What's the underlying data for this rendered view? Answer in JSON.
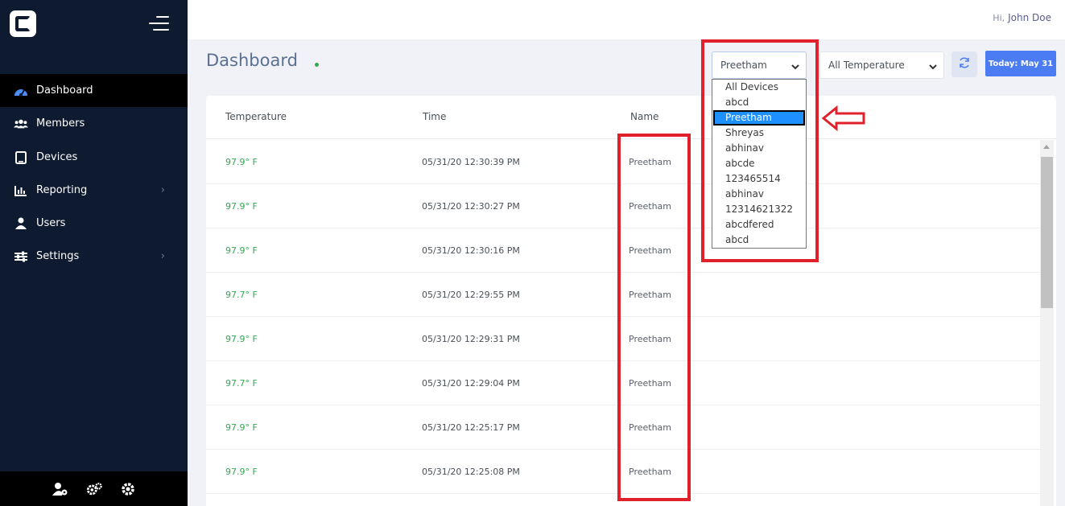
{
  "sidebar": {
    "items": [
      {
        "label": "Dashboard",
        "icon": "dashboard-icon",
        "active": true
      },
      {
        "label": "Members",
        "icon": "members-icon"
      },
      {
        "label": "Devices",
        "icon": "tablet-icon"
      },
      {
        "label": "Reporting",
        "icon": "bar-chart-icon",
        "has_submenu": true
      },
      {
        "label": "Users",
        "icon": "user-icon"
      },
      {
        "label": "Settings",
        "icon": "sliders-icon",
        "has_submenu": true
      }
    ],
    "bottom_icons": [
      "user-settings-icon",
      "cogs-icon",
      "gear-icon"
    ]
  },
  "header": {
    "greeting": "Hi,",
    "user_name": "John Doe"
  },
  "dashboard": {
    "title": "Dashboard",
    "device_select_value": "Preetham",
    "temperature_select_value": "All Temperature",
    "today_label": "Today: May 31"
  },
  "device_options": [
    "All Devices",
    "abcd",
    "Preetham",
    "Shreyas",
    "abhinav",
    "abcde",
    "123465514",
    "abhinav",
    "12314621322",
    "abcdfered",
    "abcd"
  ],
  "selected_option": "Preetham",
  "table": {
    "columns": [
      "Temperature",
      "Time",
      "Name"
    ],
    "rows": [
      {
        "temperature": "97.9° F",
        "time": "05/31/20 12:30:39 PM",
        "name": "Preetham"
      },
      {
        "temperature": "97.9° F",
        "time": "05/31/20 12:30:27 PM",
        "name": "Preetham"
      },
      {
        "temperature": "97.9° F",
        "time": "05/31/20 12:30:16 PM",
        "name": "Preetham"
      },
      {
        "temperature": "97.7° F",
        "time": "05/31/20 12:29:55 PM",
        "name": "Preetham"
      },
      {
        "temperature": "97.9° F",
        "time": "05/31/20 12:29:31 PM",
        "name": "Preetham"
      },
      {
        "temperature": "97.7° F",
        "time": "05/31/20 12:29:04 PM",
        "name": "Preetham"
      },
      {
        "temperature": "97.9° F",
        "time": "05/31/20 12:25:17 PM",
        "name": "Preetham"
      },
      {
        "temperature": "97.9° F",
        "time": "05/31/20 12:25:08 PM",
        "name": "Preetham"
      }
    ]
  },
  "colors": {
    "sidebar_bg": "#0d1a2f",
    "accent_blue": "#4c7cf3",
    "temperature_green": "#34a853",
    "annotation_red": "#e0202b",
    "option_highlight": "#1e90ff"
  }
}
